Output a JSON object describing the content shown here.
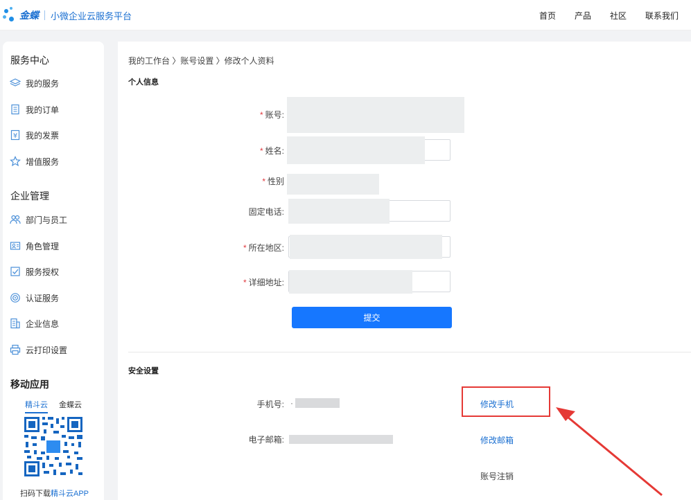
{
  "header": {
    "brand": "金蝶",
    "subtitle": "小微企业云服务平台",
    "nav": [
      "首页",
      "产品",
      "社区",
      "联系我们"
    ]
  },
  "sidebar": {
    "service_center_title": "服务中心",
    "service_items": [
      {
        "label": "我的服务",
        "icon": "layers-icon"
      },
      {
        "label": "我的订单",
        "icon": "document-icon"
      },
      {
        "label": "我的发票",
        "icon": "invoice-icon"
      },
      {
        "label": "增值服务",
        "icon": "star-icon"
      }
    ],
    "enterprise_title": "企业管理",
    "enterprise_items": [
      {
        "label": "部门与员工",
        "icon": "users-icon"
      },
      {
        "label": "角色管理",
        "icon": "id-card-icon"
      },
      {
        "label": "服务授权",
        "icon": "authorize-icon"
      },
      {
        "label": "认证服务",
        "icon": "certificate-icon"
      },
      {
        "label": "企业信息",
        "icon": "enterprise-info-icon"
      },
      {
        "label": "云打印设置",
        "icon": "printer-icon"
      }
    ],
    "mobile_title": "移动应用",
    "app_tabs": [
      "精斗云",
      "金蝶云"
    ],
    "app_caption_prefix": "扫码下载",
    "app_caption_link": "精斗云APP"
  },
  "main": {
    "breadcrumb": "我的工作台 〉账号设置 〉修改个人资料",
    "personal_title": "个人信息",
    "fields": [
      {
        "label": "账号:",
        "required": true
      },
      {
        "label": "姓名:",
        "required": true
      },
      {
        "label": "性别",
        "required": true
      },
      {
        "label": "固定电话:",
        "required": false
      },
      {
        "label": "所在地区:",
        "required": true
      },
      {
        "label": "详细地址:",
        "required": true
      }
    ],
    "submit_label": "提交",
    "security_title": "安全设置",
    "phone_label": "手机号:",
    "phone_masked": "·",
    "email_label": "电子邮箱:",
    "change_phone": "修改手机",
    "change_email": "修改邮箱",
    "cancel_account": "账号注销"
  },
  "colors": {
    "accent": "#1677ff",
    "brand_blue": "#1a6fd1",
    "required_star": "#e0393e",
    "annotation_red": "#e53935"
  }
}
